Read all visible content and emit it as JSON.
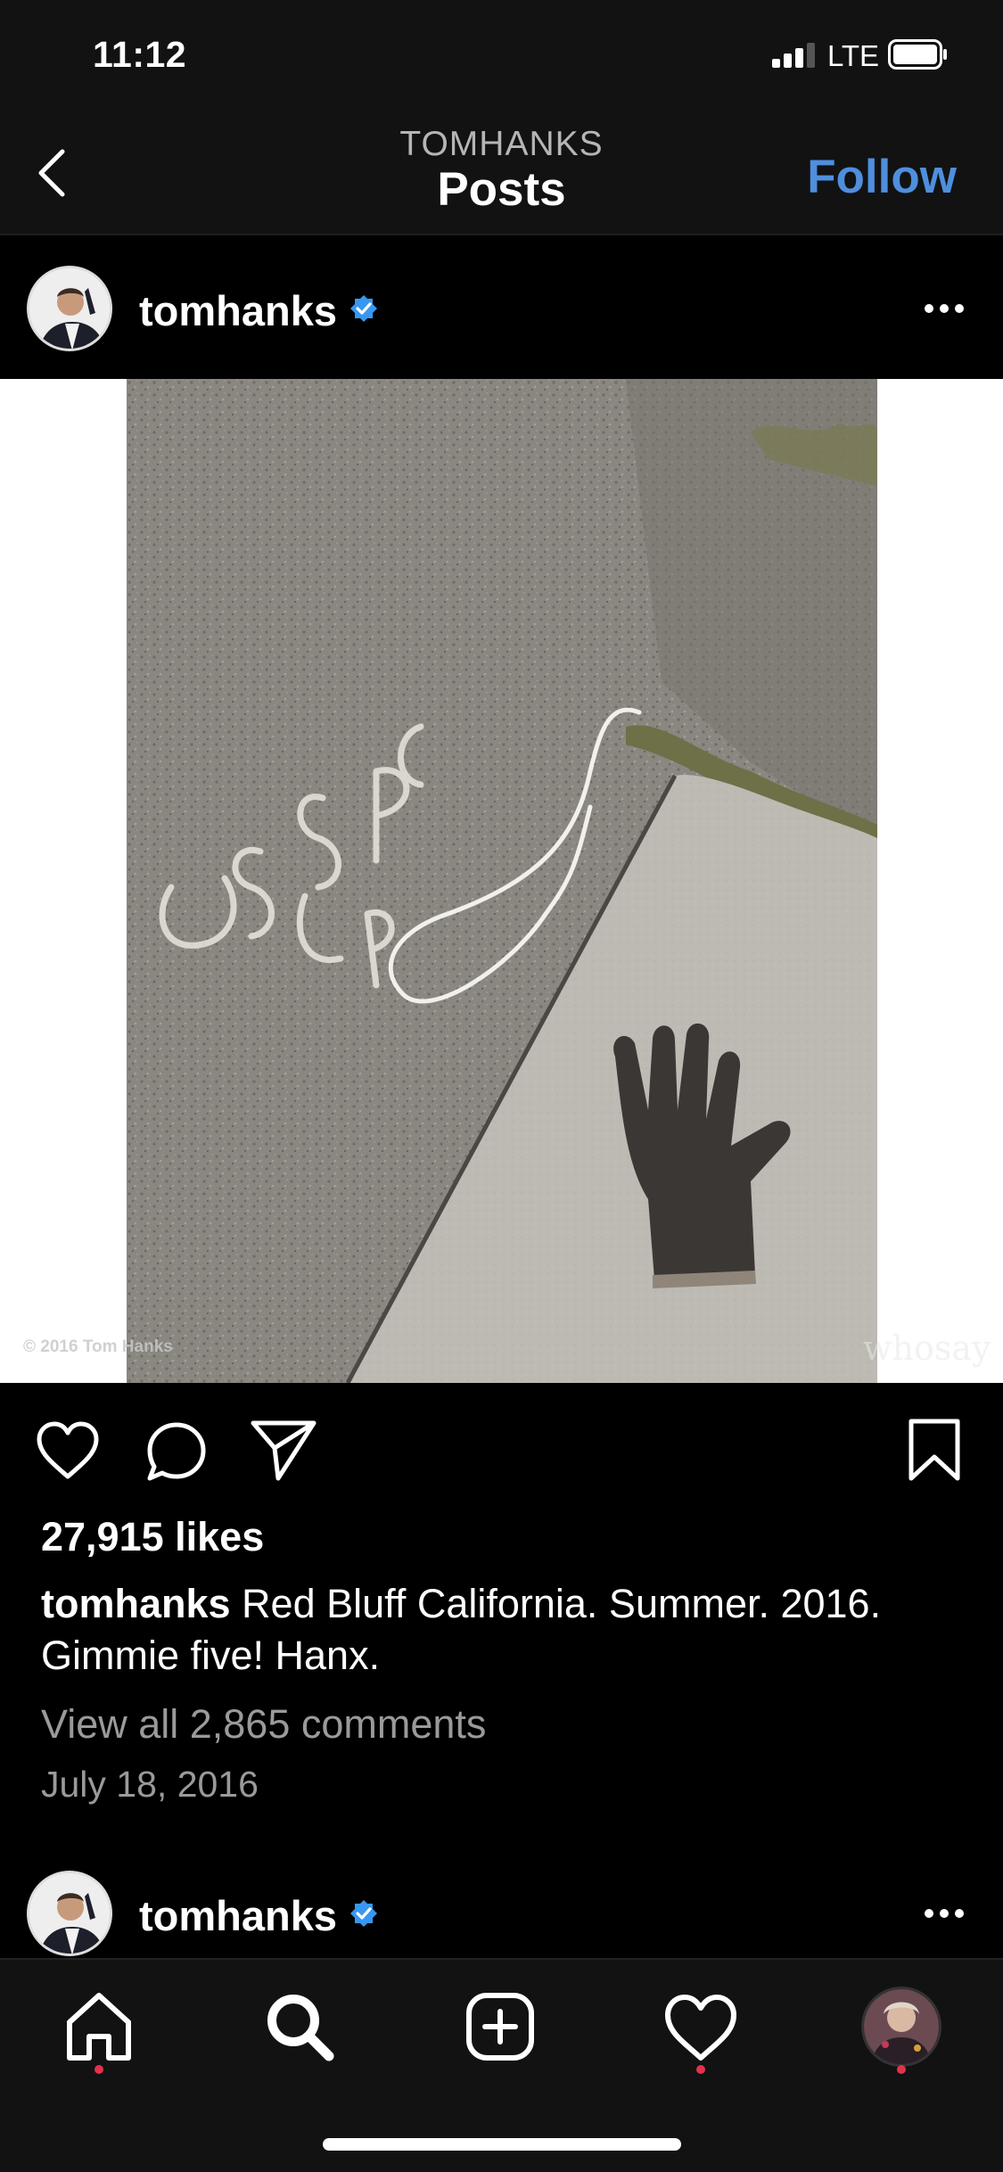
{
  "status_bar": {
    "time": "11:12",
    "network": "LTE"
  },
  "nav": {
    "username": "TOMHANKS",
    "title": "Posts",
    "follow_label": "Follow"
  },
  "post": {
    "username": "tomhanks",
    "verified": true,
    "media_copyright": "© 2016 Tom Hanks",
    "media_watermark": "whosay",
    "likes": "27,915 likes",
    "caption_user": "tomhanks",
    "caption_text": " Red Bluff California. Summer. 2016. Gimmie five!  Hanx.",
    "view_comments": "View all 2,865 comments",
    "date": "July 18, 2016"
  },
  "next_post": {
    "username": "tomhanks",
    "verified": true
  },
  "tabs": [
    {
      "icon": "home-icon",
      "notification": true
    },
    {
      "icon": "search-icon",
      "notification": false
    },
    {
      "icon": "new-post-icon",
      "notification": false
    },
    {
      "icon": "activity-heart-icon",
      "notification": true
    },
    {
      "icon": "profile-avatar-icon",
      "notification": true
    }
  ],
  "colors": {
    "accent": "#4e8fde",
    "verified": "#3897f0",
    "notification": "#e3324b",
    "bar_bg": "#121212"
  }
}
